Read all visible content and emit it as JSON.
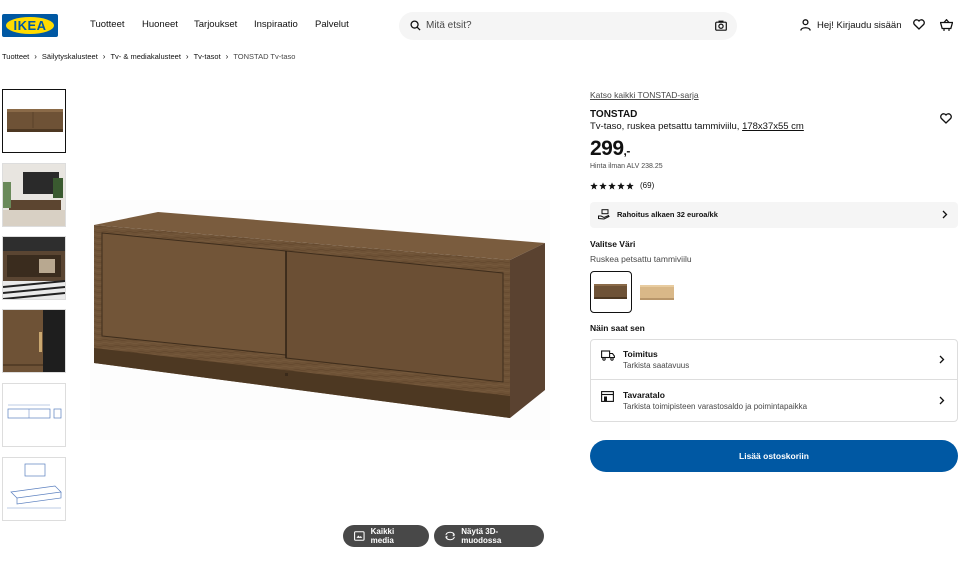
{
  "brand": {
    "logo_text": "IKEA",
    "primary": "#0058a3",
    "yellow": "#ffdb00"
  },
  "nav": {
    "items": [
      "Tuotteet",
      "Huoneet",
      "Tarjoukset",
      "Inspiraatio",
      "Palvelut"
    ]
  },
  "search": {
    "placeholder": "Mitä etsit?"
  },
  "account": {
    "label": "Hej! Kirjaudu sisään"
  },
  "breadcrumb": [
    "Tuotteet",
    "Säilytyskalusteet",
    "Tv- & mediakalusteet",
    "Tv-tasot",
    "TONSTAD Tv-taso"
  ],
  "media": {
    "all_media": "Kaikki media",
    "view_3d": "Näytä 3D-muodossa"
  },
  "product": {
    "series_link": "Katso kaikki TONSTAD-sarja",
    "name": "TONSTAD",
    "description": "Tv-taso, ruskea petsattu tammiviilu, ",
    "dimensions": "178x37x55 cm",
    "price_main": "299",
    "price_suffix": ",-",
    "vat_text": "Hinta ilman ALV 238.25",
    "rating": 5,
    "review_count": "(69)",
    "financing": "Rahoitus alkaen 32 euroa/kk",
    "color_title": "Valitse Väri",
    "color_value": "Ruskea petsattu tammiviilu",
    "swatches": [
      {
        "color": "#7a5a3a",
        "selected": true
      },
      {
        "color": "#d9b888",
        "selected": false
      }
    ],
    "get_title": "Näin saat sen",
    "delivery": {
      "title": "Toimitus",
      "sub": "Tarkista saatavuus"
    },
    "store": {
      "title": "Tavaratalo",
      "sub": "Tarkista toimipisteen varastosaldo ja poimintapaikka"
    },
    "add_to_cart": "Lisää ostoskoriin"
  }
}
